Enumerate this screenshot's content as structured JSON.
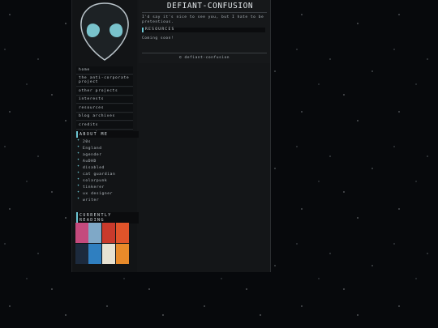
{
  "header": {
    "site_title": "DEFIANT-CONFUSION",
    "intro": "I'd say it's nice to see you, but I hate to be pretentious.",
    "resources_heading": "RESOURCES",
    "resources_text": "Coming soon!",
    "footer": "© defiant-confusion"
  },
  "sidebar": {
    "logo_icon": "alien-head-icon",
    "nav": [
      {
        "label": "home"
      },
      {
        "label": "the anti-corporate project"
      },
      {
        "label": "other projects"
      },
      {
        "label": "interests"
      },
      {
        "label": "resources"
      },
      {
        "label": "blog archives"
      },
      {
        "label": "credits"
      },
      {
        "label": "changelog"
      }
    ],
    "about_heading": "ABOUT ME",
    "about_items": [
      {
        "label": "20s"
      },
      {
        "label": "England"
      },
      {
        "label": "agender"
      },
      {
        "label": "AuDHD"
      },
      {
        "label": "disabled"
      },
      {
        "label": "cat guardian"
      },
      {
        "label": "solarpunk"
      },
      {
        "label": "tinkerer"
      },
      {
        "label": "ux designer"
      },
      {
        "label": "writer"
      }
    ],
    "reading_heading": "CURRENTLY READING",
    "books": [
      {
        "name": "book-cover-1",
        "color": "#c44a7d"
      },
      {
        "name": "book-cover-2",
        "color": "#7fa8c7"
      },
      {
        "name": "book-cover-3",
        "color": "#c93a2c"
      },
      {
        "name": "book-cover-4",
        "color": "#e0542a"
      },
      {
        "name": "book-cover-5",
        "color": "#1c2a3d"
      },
      {
        "name": "book-cover-6",
        "color": "#2f7fc0"
      },
      {
        "name": "book-cover-7",
        "color": "#e7e2d2"
      },
      {
        "name": "book-cover-8",
        "color": "#e88a2a"
      }
    ]
  },
  "colors": {
    "accent": "#6cc5d2",
    "panel": "#141618",
    "background": "#07090c"
  }
}
